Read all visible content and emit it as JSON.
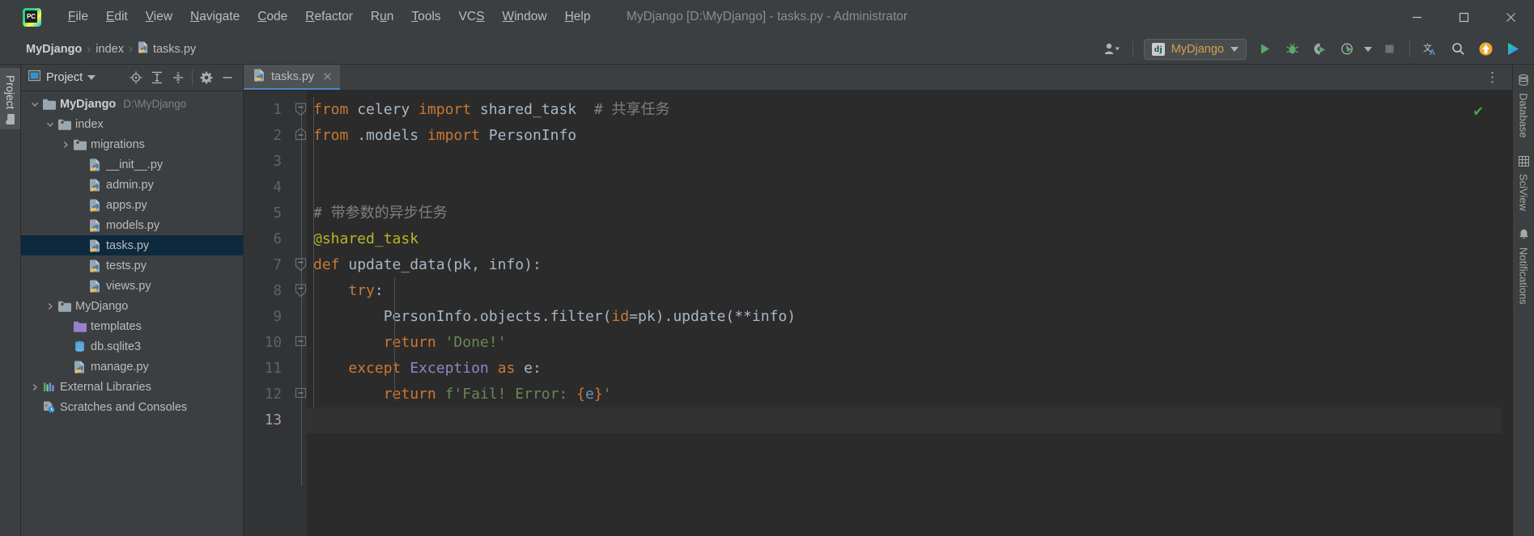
{
  "window": {
    "title": "MyDjango [D:\\MyDjango] - tasks.py - Administrator",
    "minimize_label": "─",
    "maximize_label": "□",
    "close_label": "✕"
  },
  "menu": {
    "items": [
      {
        "label": "File",
        "mnemonic": "F"
      },
      {
        "label": "Edit",
        "mnemonic": "E"
      },
      {
        "label": "View",
        "mnemonic": "V"
      },
      {
        "label": "Navigate",
        "mnemonic": "N"
      },
      {
        "label": "Code",
        "mnemonic": "C"
      },
      {
        "label": "Refactor",
        "mnemonic": "R"
      },
      {
        "label": "Run",
        "mnemonic": "u"
      },
      {
        "label": "Tools",
        "mnemonic": "T"
      },
      {
        "label": "VCS",
        "mnemonic": "S"
      },
      {
        "label": "Window",
        "mnemonic": "W"
      },
      {
        "label": "Help",
        "mnemonic": "H"
      }
    ]
  },
  "navbar": {
    "breadcrumbs": [
      "MyDjango",
      "index",
      "tasks.py"
    ],
    "separator": "›",
    "run_config": "MyDjango",
    "run_config_icon": "django-icon",
    "toolbar_icons": [
      "user-accounts-icon",
      "run-icon",
      "debug-icon",
      "run-coverage-icon",
      "profile-icon",
      "stop-icon",
      "translate-icon",
      "search-everywhere-icon",
      "update-project-icon",
      "plugin-icon"
    ]
  },
  "sidebar": {
    "vertical_tab": "Project",
    "panel_title": "Project",
    "panel_icons": [
      "locate-icon",
      "expand-all-icon",
      "collapse-all-icon",
      "settings-gear-icon",
      "hide-panel-icon"
    ],
    "tree": [
      {
        "label": "MyDjango",
        "path": "D:\\MyDjango",
        "icon": "folder-icon",
        "indent": 0,
        "twisty": "open",
        "bold": true,
        "selected": false
      },
      {
        "label": "index",
        "path": "",
        "icon": "module-folder-icon",
        "indent": 1,
        "twisty": "open",
        "bold": false,
        "selected": false
      },
      {
        "label": "migrations",
        "path": "",
        "icon": "module-folder-icon",
        "indent": 2,
        "twisty": "closed",
        "bold": false,
        "selected": false
      },
      {
        "label": "__init__.py",
        "path": "",
        "icon": "python-file-icon",
        "indent": 3,
        "twisty": "none",
        "bold": false,
        "selected": false
      },
      {
        "label": "admin.py",
        "path": "",
        "icon": "python-file-icon",
        "indent": 3,
        "twisty": "none",
        "bold": false,
        "selected": false
      },
      {
        "label": "apps.py",
        "path": "",
        "icon": "python-file-icon",
        "indent": 3,
        "twisty": "none",
        "bold": false,
        "selected": false
      },
      {
        "label": "models.py",
        "path": "",
        "icon": "python-file-icon",
        "indent": 3,
        "twisty": "none",
        "bold": false,
        "selected": false
      },
      {
        "label": "tasks.py",
        "path": "",
        "icon": "python-file-icon",
        "indent": 3,
        "twisty": "none",
        "bold": false,
        "selected": true
      },
      {
        "label": "tests.py",
        "path": "",
        "icon": "python-file-icon",
        "indent": 3,
        "twisty": "none",
        "bold": false,
        "selected": false
      },
      {
        "label": "views.py",
        "path": "",
        "icon": "python-file-icon",
        "indent": 3,
        "twisty": "none",
        "bold": false,
        "selected": false
      },
      {
        "label": "MyDjango",
        "path": "",
        "icon": "module-folder-icon",
        "indent": 1,
        "twisty": "closed",
        "bold": false,
        "selected": false
      },
      {
        "label": "templates",
        "path": "",
        "icon": "templates-folder-icon",
        "indent": 2,
        "twisty": "none",
        "bold": false,
        "selected": false
      },
      {
        "label": "db.sqlite3",
        "path": "",
        "icon": "database-file-icon",
        "indent": 2,
        "twisty": "none",
        "bold": false,
        "selected": false
      },
      {
        "label": "manage.py",
        "path": "",
        "icon": "python-file-icon",
        "indent": 2,
        "twisty": "none",
        "bold": false,
        "selected": false
      },
      {
        "label": "External Libraries",
        "path": "",
        "icon": "libraries-icon",
        "indent": 0,
        "twisty": "closed",
        "bold": false,
        "selected": false
      },
      {
        "label": "Scratches and Consoles",
        "path": "",
        "icon": "scratches-icon",
        "indent": 0,
        "twisty": "none",
        "bold": false,
        "selected": false
      }
    ]
  },
  "editor": {
    "tabs": [
      {
        "label": "tasks.py",
        "icon": "python-file-icon",
        "active": true,
        "close": "✕"
      }
    ],
    "options_icon": "more-options-icon",
    "inspection_status": "ok-checkmark",
    "current_line": 13,
    "total_lines": 13,
    "line_numbers": [
      1,
      2,
      3,
      4,
      5,
      6,
      7,
      8,
      9,
      10,
      11,
      12,
      13
    ],
    "code_lines": [
      {
        "n": 1,
        "fold": "start",
        "tokens": [
          {
            "t": "from",
            "c": "kw"
          },
          {
            "t": " celery ",
            "c": "ident"
          },
          {
            "t": "import",
            "c": "kw"
          },
          {
            "t": " shared_task  ",
            "c": "ident"
          },
          {
            "t": "# 共享任务",
            "c": "cmt"
          }
        ]
      },
      {
        "n": 2,
        "fold": "end",
        "tokens": [
          {
            "t": "from",
            "c": "kw"
          },
          {
            "t": " .models ",
            "c": "ident"
          },
          {
            "t": "import",
            "c": "kw"
          },
          {
            "t": " PersonInfo",
            "c": "ident"
          }
        ]
      },
      {
        "n": 3,
        "fold": "none",
        "tokens": []
      },
      {
        "n": 4,
        "fold": "none",
        "tokens": []
      },
      {
        "n": 5,
        "fold": "none",
        "tokens": [
          {
            "t": "# 带参数的异步任务",
            "c": "cmt"
          }
        ]
      },
      {
        "n": 6,
        "fold": "none",
        "tokens": [
          {
            "t": "@shared_task",
            "c": "deco"
          }
        ]
      },
      {
        "n": 7,
        "fold": "start",
        "tokens": [
          {
            "t": "def",
            "c": "kw"
          },
          {
            "t": " ",
            "c": "ident"
          },
          {
            "t": "update_data",
            "c": "fn"
          },
          {
            "t": "(pk, info):",
            "c": "ident"
          }
        ]
      },
      {
        "n": 8,
        "fold": "start2",
        "tokens": [
          {
            "t": "    ",
            "c": "ident"
          },
          {
            "t": "try",
            "c": "kw"
          },
          {
            "t": ":",
            "c": "ident"
          }
        ]
      },
      {
        "n": 9,
        "fold": "none",
        "tokens": [
          {
            "t": "        PersonInfo.objects.filter(",
            "c": "ident"
          },
          {
            "t": "id",
            "c": "kwarg"
          },
          {
            "t": "=pk).update(**info)",
            "c": "ident"
          }
        ]
      },
      {
        "n": 10,
        "fold": "mid",
        "tokens": [
          {
            "t": "        ",
            "c": "ident"
          },
          {
            "t": "return",
            "c": "kw"
          },
          {
            "t": " ",
            "c": "ident"
          },
          {
            "t": "'Done!'",
            "c": "str"
          }
        ]
      },
      {
        "n": 11,
        "fold": "none",
        "tokens": [
          {
            "t": "    ",
            "c": "ident"
          },
          {
            "t": "except",
            "c": "kw"
          },
          {
            "t": " ",
            "c": "ident"
          },
          {
            "t": "Exception",
            "c": "exc"
          },
          {
            "t": " ",
            "c": "ident"
          },
          {
            "t": "as",
            "c": "kw"
          },
          {
            "t": " e:",
            "c": "ident"
          }
        ]
      },
      {
        "n": 12,
        "fold": "mid",
        "tokens": [
          {
            "t": "        ",
            "c": "ident"
          },
          {
            "t": "return",
            "c": "kw"
          },
          {
            "t": " ",
            "c": "ident"
          },
          {
            "t": "f'Fail! Error: ",
            "c": "str"
          },
          {
            "t": "{",
            "c": "brace"
          },
          {
            "t": "e",
            "c": "num"
          },
          {
            "t": "}",
            "c": "brace"
          },
          {
            "t": "'",
            "c": "str"
          }
        ]
      },
      {
        "n": 13,
        "fold": "none",
        "tokens": []
      }
    ]
  },
  "right_strip": {
    "tabs": [
      {
        "label": "Database",
        "icon": "database-icon"
      },
      {
        "label": "SciView",
        "icon": "sciview-grid-icon"
      },
      {
        "label": "Notifications",
        "icon": "bell-icon"
      }
    ]
  },
  "colors": {
    "chrome": "#3C3F41",
    "editor_bg": "#2B2B2B",
    "gutter_bg": "#313335",
    "selection": "#0D293E",
    "keyword": "#CC7832",
    "string": "#6A8759",
    "comment": "#808080",
    "decorator": "#BBB529",
    "identifier": "#A9B7C6",
    "tab_underline": "#4A88C7",
    "accent_orange": "#D6A050"
  }
}
